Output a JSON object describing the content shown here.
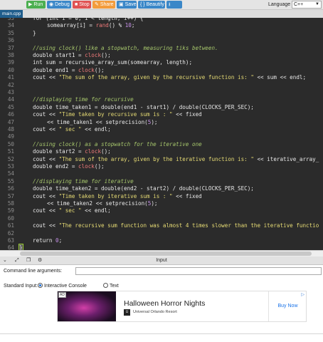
{
  "toolbar": {
    "buttons": [
      {
        "label": "Run",
        "icon": "play-icon",
        "color": "#4caf50"
      },
      {
        "label": "Debug",
        "icon": "bug-icon",
        "color": "#3a87c8"
      },
      {
        "label": "Stop",
        "icon": "stop-icon",
        "color": "#e05252"
      },
      {
        "label": "Share",
        "icon": "share-icon",
        "color": "#f39c3c"
      },
      {
        "label": "Save",
        "icon": "save-icon",
        "color": "#3a87c8"
      },
      {
        "label": "{ } Beautify",
        "icon": "",
        "color": "#3a87c8"
      },
      {
        "label": "",
        "icon": "download-icon",
        "color": "#3a87c8"
      }
    ],
    "language_label": "Language",
    "language_value": "C++"
  },
  "file_tab": "main.cpp",
  "editor": {
    "lines": [
      {
        "n": "33",
        "indent": 1,
        "tokens": [
          [
            "kw",
            "for (int i = 0; i < length; i++) {"
          ]
        ]
      },
      {
        "n": "34",
        "indent": 2,
        "tokens": [
          [
            "kw",
            "somearray[i] = "
          ],
          [
            "fn",
            "rand"
          ],
          [
            "kw",
            "() % "
          ],
          [
            "num",
            "10"
          ],
          [
            "kw",
            ";"
          ]
        ]
      },
      {
        "n": "35",
        "indent": 1,
        "tokens": [
          [
            "kw",
            "}"
          ]
        ]
      },
      {
        "n": "36",
        "indent": 1,
        "tokens": []
      },
      {
        "n": "37",
        "indent": 1,
        "tokens": [
          [
            "cm",
            "//using clock() like a stopwatch, measuring tiks between."
          ]
        ]
      },
      {
        "n": "38",
        "indent": 1,
        "tokens": [
          [
            "kw",
            "double start1 = "
          ],
          [
            "fn",
            "clock"
          ],
          [
            "kw",
            "();"
          ]
        ]
      },
      {
        "n": "39",
        "indent": 1,
        "tokens": [
          [
            "kw",
            "int sum = recursive_array_sum(somearray, length);"
          ]
        ]
      },
      {
        "n": "40",
        "indent": 1,
        "tokens": [
          [
            "kw",
            "double end1 = "
          ],
          [
            "fn",
            "clock"
          ],
          [
            "kw",
            "();"
          ]
        ]
      },
      {
        "n": "41",
        "indent": 1,
        "tokens": [
          [
            "kw",
            "cout << "
          ],
          [
            "str",
            "\"The sum of the array, given by the recursive function is: \""
          ],
          [
            "kw",
            " << sum << endl;"
          ]
        ]
      },
      {
        "n": "42",
        "indent": 1,
        "tokens": []
      },
      {
        "n": "43",
        "indent": 1,
        "tokens": []
      },
      {
        "n": "44",
        "indent": 1,
        "tokens": [
          [
            "cm",
            "//displaying time for recursive"
          ]
        ]
      },
      {
        "n": "45",
        "indent": 1,
        "tokens": [
          [
            "kw",
            "double time_taken1 = double(end1 - start1) / double(CLOCKS_PER_SEC);"
          ]
        ]
      },
      {
        "n": "46",
        "indent": 1,
        "tokens": [
          [
            "kw",
            "cout << "
          ],
          [
            "str",
            "\"Time taken by recursive sum is : \""
          ],
          [
            "kw",
            " << fixed"
          ]
        ]
      },
      {
        "n": "47",
        "indent": 2,
        "tokens": [
          [
            "kw",
            "<< time_taken1 << setprecision("
          ],
          [
            "num",
            "5"
          ],
          [
            "kw",
            ");"
          ]
        ]
      },
      {
        "n": "48",
        "indent": 1,
        "tokens": [
          [
            "kw",
            "cout << "
          ],
          [
            "str",
            "\" sec \""
          ],
          [
            "kw",
            " << endl;"
          ]
        ]
      },
      {
        "n": "49",
        "indent": 1,
        "tokens": []
      },
      {
        "n": "50",
        "indent": 1,
        "tokens": [
          [
            "cm",
            "//using clock() as a stopwatch for the iterative one"
          ]
        ]
      },
      {
        "n": "51",
        "indent": 1,
        "tokens": [
          [
            "kw",
            "double start2 = "
          ],
          [
            "fn",
            "clock"
          ],
          [
            "kw",
            "();"
          ]
        ]
      },
      {
        "n": "52",
        "indent": 1,
        "tokens": [
          [
            "kw",
            "cout << "
          ],
          [
            "str",
            "\"The sum of the array, given by the iterative function is: \""
          ],
          [
            "kw",
            " << iterative_array_"
          ]
        ]
      },
      {
        "n": "53",
        "indent": 1,
        "tokens": [
          [
            "kw",
            "double end2 = "
          ],
          [
            "fn",
            "clock"
          ],
          [
            "kw",
            "();"
          ]
        ]
      },
      {
        "n": "54",
        "indent": 1,
        "tokens": []
      },
      {
        "n": "55",
        "indent": 1,
        "tokens": [
          [
            "cm",
            "//displaying time for iterative"
          ]
        ]
      },
      {
        "n": "56",
        "indent": 1,
        "tokens": [
          [
            "kw",
            "double time_taken2 = double(end2 - start2) / double(CLOCKS_PER_SEC);"
          ]
        ]
      },
      {
        "n": "57",
        "indent": 1,
        "tokens": [
          [
            "kw",
            "cout << "
          ],
          [
            "str",
            "\"Time taken by iterative sum is : \""
          ],
          [
            "kw",
            " << fixed"
          ]
        ]
      },
      {
        "n": "58",
        "indent": 2,
        "tokens": [
          [
            "kw",
            "<< time_taken2 << setprecision("
          ],
          [
            "num",
            "5"
          ],
          [
            "kw",
            ");"
          ]
        ]
      },
      {
        "n": "59",
        "indent": 1,
        "tokens": [
          [
            "kw",
            "cout << "
          ],
          [
            "str",
            "\" sec \""
          ],
          [
            "kw",
            " << endl;"
          ]
        ]
      },
      {
        "n": "60",
        "indent": 1,
        "tokens": []
      },
      {
        "n": "61",
        "indent": 1,
        "tokens": [
          [
            "kw",
            "cout << "
          ],
          [
            "str",
            "\"The recursive sum function was almost 4 times slower than the iterative functio"
          ]
        ]
      },
      {
        "n": "62",
        "indent": 1,
        "tokens": []
      },
      {
        "n": "63",
        "indent": 1,
        "tokens": [
          [
            "kw",
            "return "
          ],
          [
            "num",
            "0"
          ],
          [
            "kw",
            ";"
          ]
        ]
      },
      {
        "n": "64",
        "indent": 0,
        "tokens": [
          [
            "brace",
            "}"
          ]
        ]
      }
    ]
  },
  "input_panel": {
    "title": "Input",
    "icons": [
      "chevron-down-icon",
      "expand-icon",
      "copy-icon",
      "settings-icon"
    ],
    "cmd_label": "Command line arguments:",
    "cmd_value": "",
    "std_label": "Standard Input:",
    "options": [
      "Interactive Console",
      "Text"
    ],
    "selected": "Interactive Console"
  },
  "ad": {
    "tag": "AD",
    "title": "Halloween Horror Nights",
    "subtitle": "Universal Orlando Resort",
    "cta": "Buy Now"
  }
}
